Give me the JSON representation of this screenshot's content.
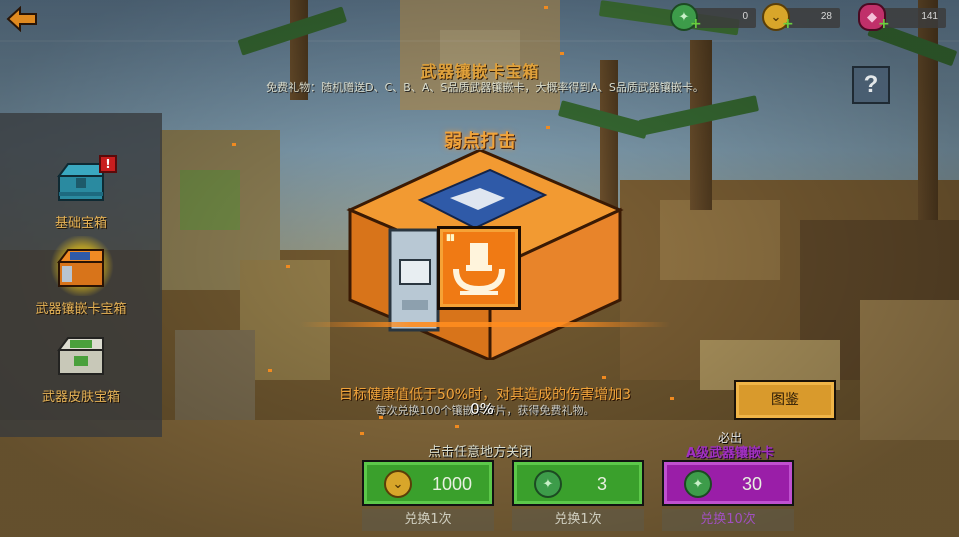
{
  "top_bar": {
    "currencies": [
      {
        "name": "gem-green",
        "value": "0",
        "color": "#3d9c4a"
      },
      {
        "name": "coin-gold",
        "value": "28",
        "color": "#d8a62a"
      },
      {
        "name": "crystal-pink",
        "value": "141",
        "color": "#c0306a"
      }
    ]
  },
  "header": {
    "title": "武器镶嵌卡宝箱",
    "description": "免费礼物：随机赠送D、C、B、A、S品质武器镶嵌卡，大概率得到A、S品质武器镶嵌卡。",
    "help_label": "?"
  },
  "sidebar": {
    "items": [
      {
        "label": "基础宝箱",
        "has_badge": true,
        "badge": "!"
      },
      {
        "label": "武器镶嵌卡宝箱",
        "selected": true
      },
      {
        "label": "武器皮肤宝箱"
      }
    ]
  },
  "main": {
    "skill_name": "弱点打击",
    "skill_desc": "目标健康值低于50%时，对其造成的伤害增加3",
    "exchange_note": "每次兑换100个镶嵌卡碎片，获得免费礼物。",
    "progress_pct": "0%",
    "close_hint": "点击任意地方关闭",
    "gallery_label": "图鉴"
  },
  "purchase": {
    "guarantee_label": "必出",
    "guarantee_item": "A级武器镶嵌卡",
    "options": [
      {
        "price": "1000",
        "currency": "coin-gold",
        "sub": "兑换1次",
        "style": "green"
      },
      {
        "price": "3",
        "currency": "gem-green",
        "sub": "兑换1次",
        "style": "green"
      },
      {
        "price": "30",
        "currency": "gem-green",
        "sub": "兑换10次",
        "style": "purple"
      }
    ]
  },
  "colors": {
    "accent_orange": "#f0a33a",
    "buy_green": "#3aa02c",
    "buy_purple": "#9a1ea8",
    "gallery_gold": "#d99a2c"
  }
}
